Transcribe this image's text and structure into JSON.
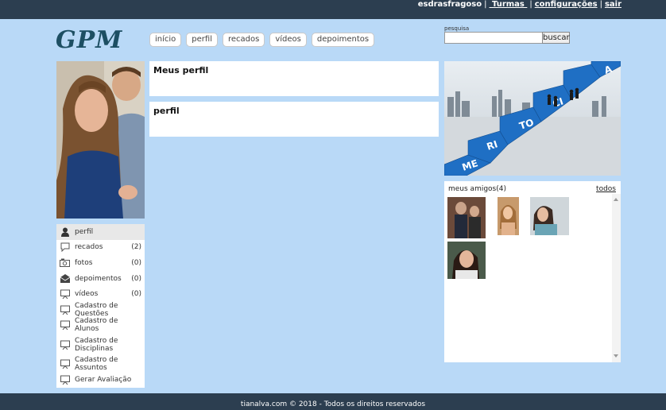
{
  "topbar": {
    "username": "esdrasfragoso",
    "turmas": " Turmas ",
    "configuracoes": "configurações",
    "sair": "sair"
  },
  "logo": "GPM",
  "nav": [
    "início",
    "perfil",
    "recados",
    "vídeos",
    "depoimentos"
  ],
  "search": {
    "label": "pesquisa",
    "placeholder": "",
    "button": "buscar"
  },
  "sidebar": {
    "items": [
      {
        "label": "perfil",
        "count": "",
        "icon": "person-icon"
      },
      {
        "label": "recados",
        "count": "(2)",
        "icon": "speech-bubble-icon"
      },
      {
        "label": "fotos",
        "count": "(0)",
        "icon": "camera-icon"
      },
      {
        "label": "depoimentos",
        "count": "(0)",
        "icon": "envelope-icon"
      },
      {
        "label": "vídeos",
        "count": "(0)",
        "icon": "video-screen-icon"
      },
      {
        "label": "Cadastro de Questões",
        "count": "",
        "icon": "board-icon"
      },
      {
        "label": "Cadastro de Alunos",
        "count": "",
        "icon": "board-icon"
      },
      {
        "label": "Cadastro de Disciplinas",
        "count": "",
        "icon": "board-icon"
      },
      {
        "label": "Cadastro de Assuntos",
        "count": "",
        "icon": "board-icon"
      },
      {
        "label": "Gerar Avaliação",
        "count": "",
        "icon": "board-icon"
      }
    ]
  },
  "panels": {
    "meus_perfil": "Meus perfil",
    "perfil": "perfil"
  },
  "banner": {
    "letters": [
      "ME",
      "RI",
      "TO",
      "CI",
      "A"
    ]
  },
  "friends": {
    "title": "meus amigos(4)",
    "all_link": "todos"
  },
  "footer": "tianalva.com © 2018 - Todos os direitos reservados",
  "colors": {
    "background": "#b9d9f7",
    "topbar": "#2c3e50",
    "banner_blue": "#1f6fc4"
  }
}
